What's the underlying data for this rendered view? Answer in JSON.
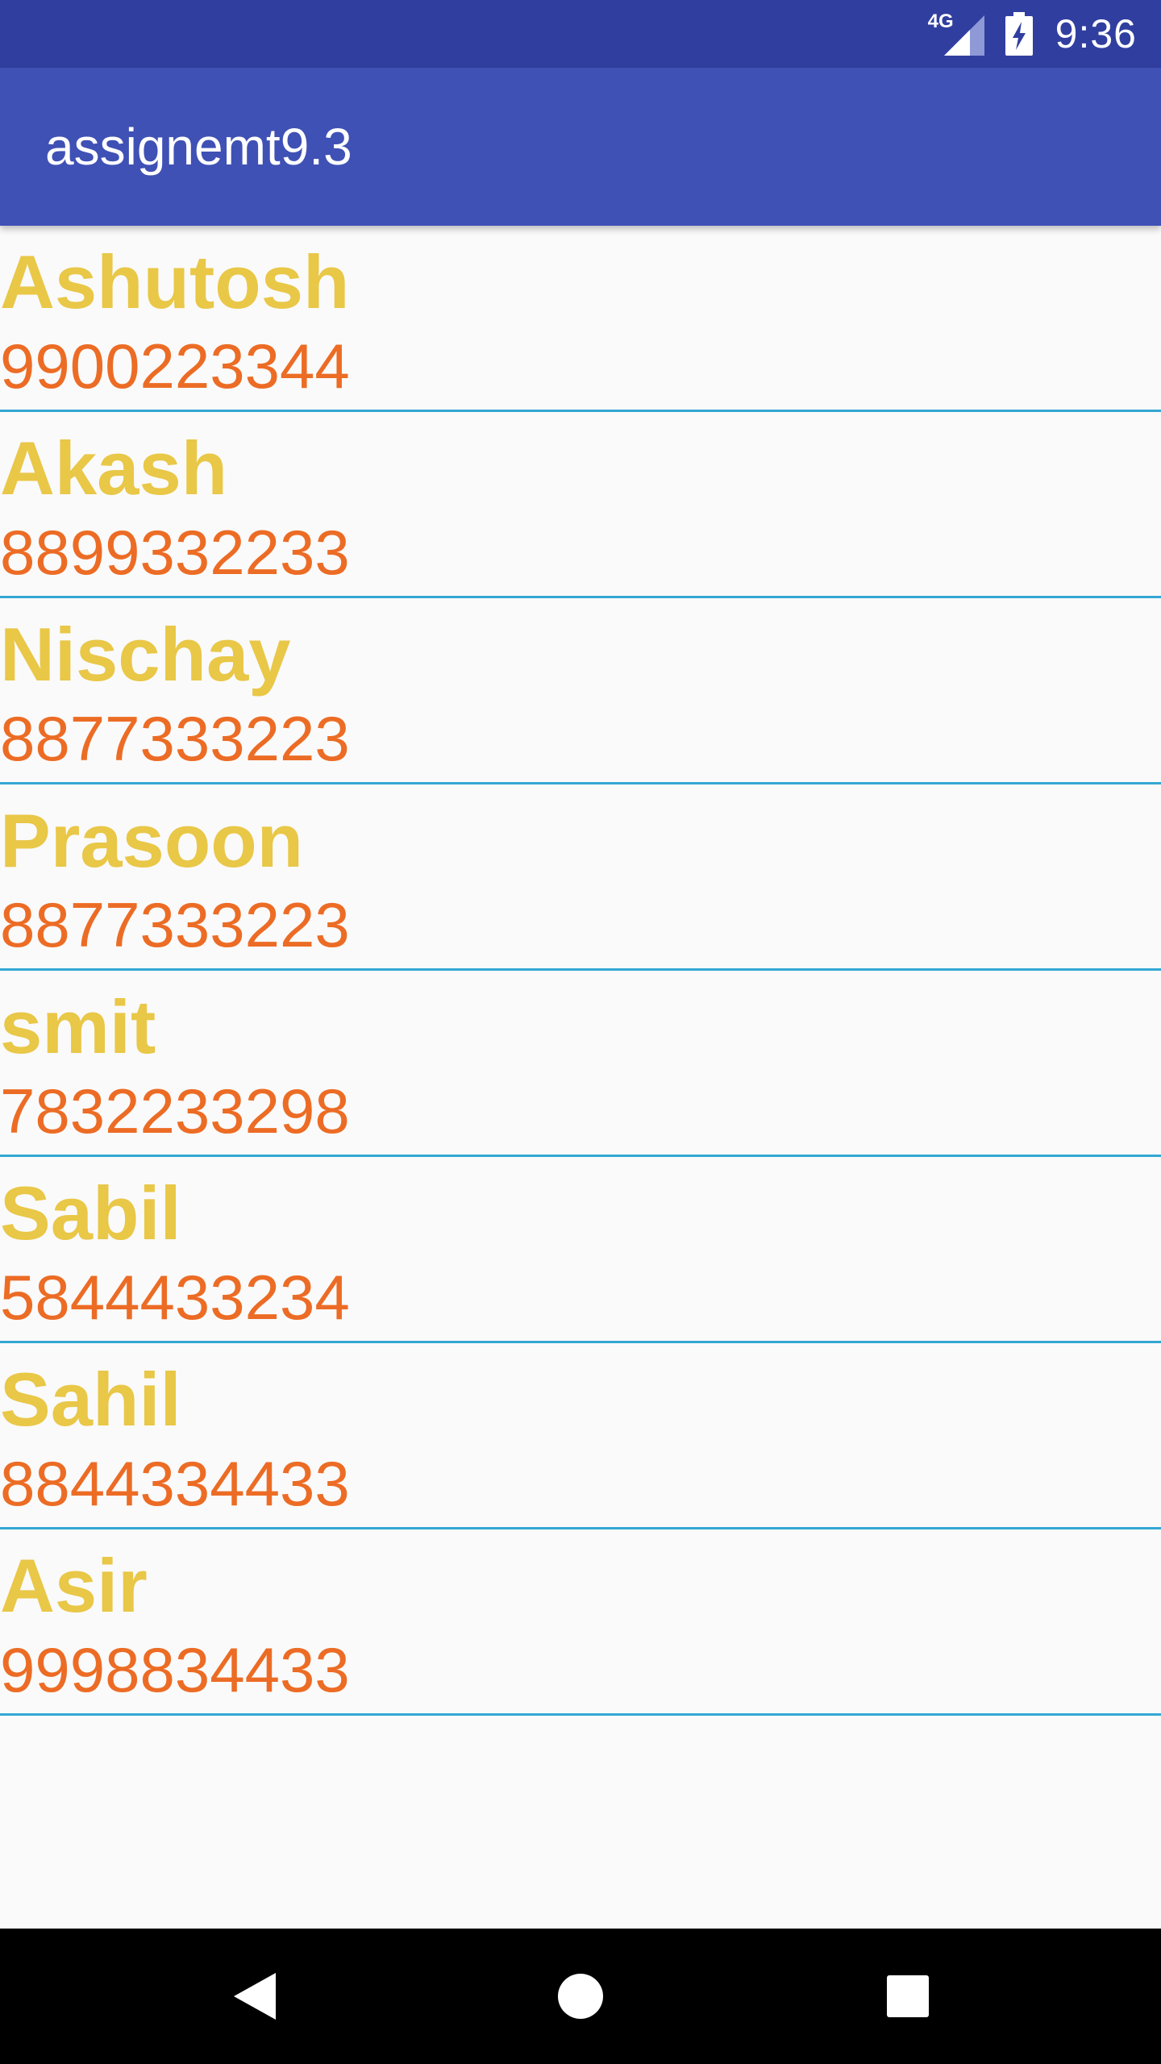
{
  "status_bar": {
    "network_label": "4G",
    "time": "9:36",
    "icons": [
      "signal-icon",
      "battery-charging-icon"
    ]
  },
  "app_bar": {
    "title": "assignemt9.3",
    "background": "#3f51b5"
  },
  "colors": {
    "status_bar": "#303f9f",
    "name": "#e9c747",
    "phone": "#ec6c25",
    "divider": "#33a7d3",
    "background": "#fafafa"
  },
  "contacts": [
    {
      "name": "Ashutosh",
      "phone": "9900223344"
    },
    {
      "name": "Akash",
      "phone": "8899332233"
    },
    {
      "name": "Nischay",
      "phone": "8877333223"
    },
    {
      "name": "Prasoon",
      "phone": "8877333223"
    },
    {
      "name": "smit",
      "phone": "7832233298"
    },
    {
      "name": "Sabil",
      "phone": "5844433234"
    },
    {
      "name": "Sahil",
      "phone": "8844334433"
    },
    {
      "name": "Asir",
      "phone": "9998834433"
    }
  ],
  "nav_bar": {
    "icons": [
      "back-icon",
      "home-icon",
      "recents-icon"
    ]
  }
}
